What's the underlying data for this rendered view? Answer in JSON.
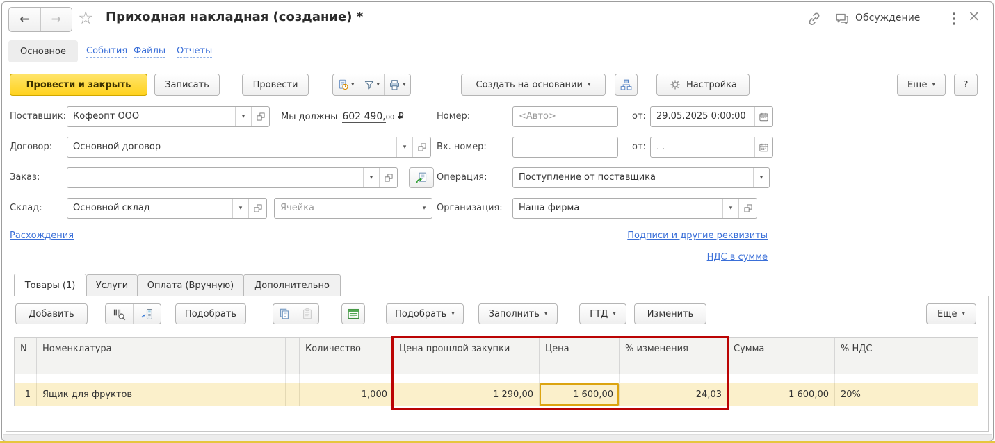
{
  "titlebar": {
    "title": "Приходная накладная (создание) *",
    "discussion": "Обсуждение"
  },
  "nav_tabs": {
    "main": "Основное",
    "events": "События",
    "files": "Файлы",
    "reports": "Отчеты"
  },
  "cmdbar": {
    "post_and_close": "Провести и закрыть",
    "save": "Записать",
    "post": "Провести",
    "create_based_on": "Создать на основании",
    "settings": "Настройка",
    "more": "Еще",
    "help": "?"
  },
  "form": {
    "supplier_label": "Поставщик:",
    "supplier_value": "Кофеопт ООО",
    "debt_prefix": "Мы должны",
    "debt_amount": "602 490,",
    "debt_decimals": "00",
    "debt_currency": "₽",
    "number_label": "Номер:",
    "number_placeholder": "<Авто>",
    "date_label": "от:",
    "date_value": "29.05.2025  0:00:00",
    "contract_label": "Договор:",
    "contract_value": "Основной договор",
    "in_number_label": "Вх. номер:",
    "in_number_value": "",
    "in_date_label": "от:",
    "in_date_placeholder": ". .",
    "order_label": "Заказ:",
    "order_value": "",
    "operation_label": "Операция:",
    "operation_value": "Поступление от поставщика",
    "warehouse_label": "Склад:",
    "warehouse_value": "Основной склад",
    "cell_placeholder": "Ячейка",
    "organization_label": "Организация:",
    "organization_value": "Наша фирма"
  },
  "links": {
    "discrepancies": "Расхождения",
    "signatures": "Подписи и другие реквизиты",
    "vat": "НДС в сумме"
  },
  "section_tabs": {
    "goods": "Товары (1)",
    "services": "Услуги",
    "payment": "Оплата (Вручную)",
    "additional": "Дополнительно"
  },
  "grid_toolbar": {
    "add": "Добавить",
    "pick": "Подобрать",
    "pick_menu": "Подобрать",
    "fill_menu": "Заполнить",
    "gtd": "ГТД",
    "edit": "Изменить",
    "more": "Еще"
  },
  "grid": {
    "headers": [
      "N",
      "Номенклатура",
      "",
      "Количество",
      "Цена прошлой закупки",
      "Цена",
      "% изменения",
      "Сумма",
      "% НДС"
    ],
    "rows": [
      {
        "n": "1",
        "item": "Ящик для фруктов",
        "qty": "1,000",
        "last_price": "1 290,00",
        "price": "1 600,00",
        "change_pct": "24,03",
        "sum": "1 600,00",
        "vat": "20%"
      }
    ]
  },
  "colors": {
    "accent_yellow": "#ffd21e",
    "row_highlight": "#fbf0cb",
    "focus_cell_border": "#dca410",
    "annotation_red": "#bb0404",
    "link_blue": "#3a6fd8"
  }
}
